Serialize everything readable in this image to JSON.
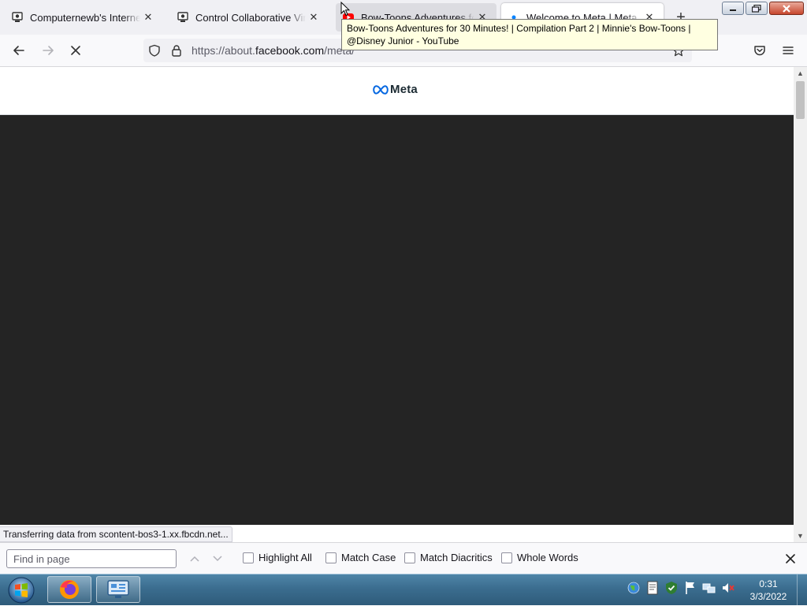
{
  "browser": {
    "tabs": [
      {
        "label": "Computernewb's Internet Pu",
        "icon": "computer-icon",
        "close": "✕"
      },
      {
        "label": "Control Collaborative Virtual",
        "icon": "computer-icon",
        "close": "✕"
      },
      {
        "label": "Bow-Toons Adventures for",
        "icon": "youtube-icon",
        "close": "✕"
      },
      {
        "label": "Welcome to Meta | Meta",
        "icon": "loading-dot-icon",
        "close": "✕"
      }
    ],
    "new_tab": "+",
    "tooltip": "Bow-Toons Adventures for 30 Minutes! | Compilation Part 2 | Minnie's Bow-Toons | @Disney Junior - YouTube",
    "url": {
      "prefix": "https://about.",
      "domain": "facebook.com",
      "path": "/meta/"
    },
    "status": "Transferring data from scontent-bos3-1.xx.fbcdn.net..."
  },
  "page": {
    "logo_text": "Meta",
    "brand_color": "#0668e1",
    "background": "#242424"
  },
  "findbar": {
    "placeholder": "Find in page",
    "value": "",
    "options": [
      {
        "label": "Highlight All",
        "checked": false
      },
      {
        "label": "Match Case",
        "checked": false
      },
      {
        "label": "Match Diacritics",
        "checked": false
      },
      {
        "label": "Whole Words",
        "checked": false
      }
    ]
  },
  "taskbar": {
    "time": "0:31",
    "date": "3/3/2022",
    "apps": [
      "firefox-icon",
      "control-panel-icon"
    ]
  }
}
